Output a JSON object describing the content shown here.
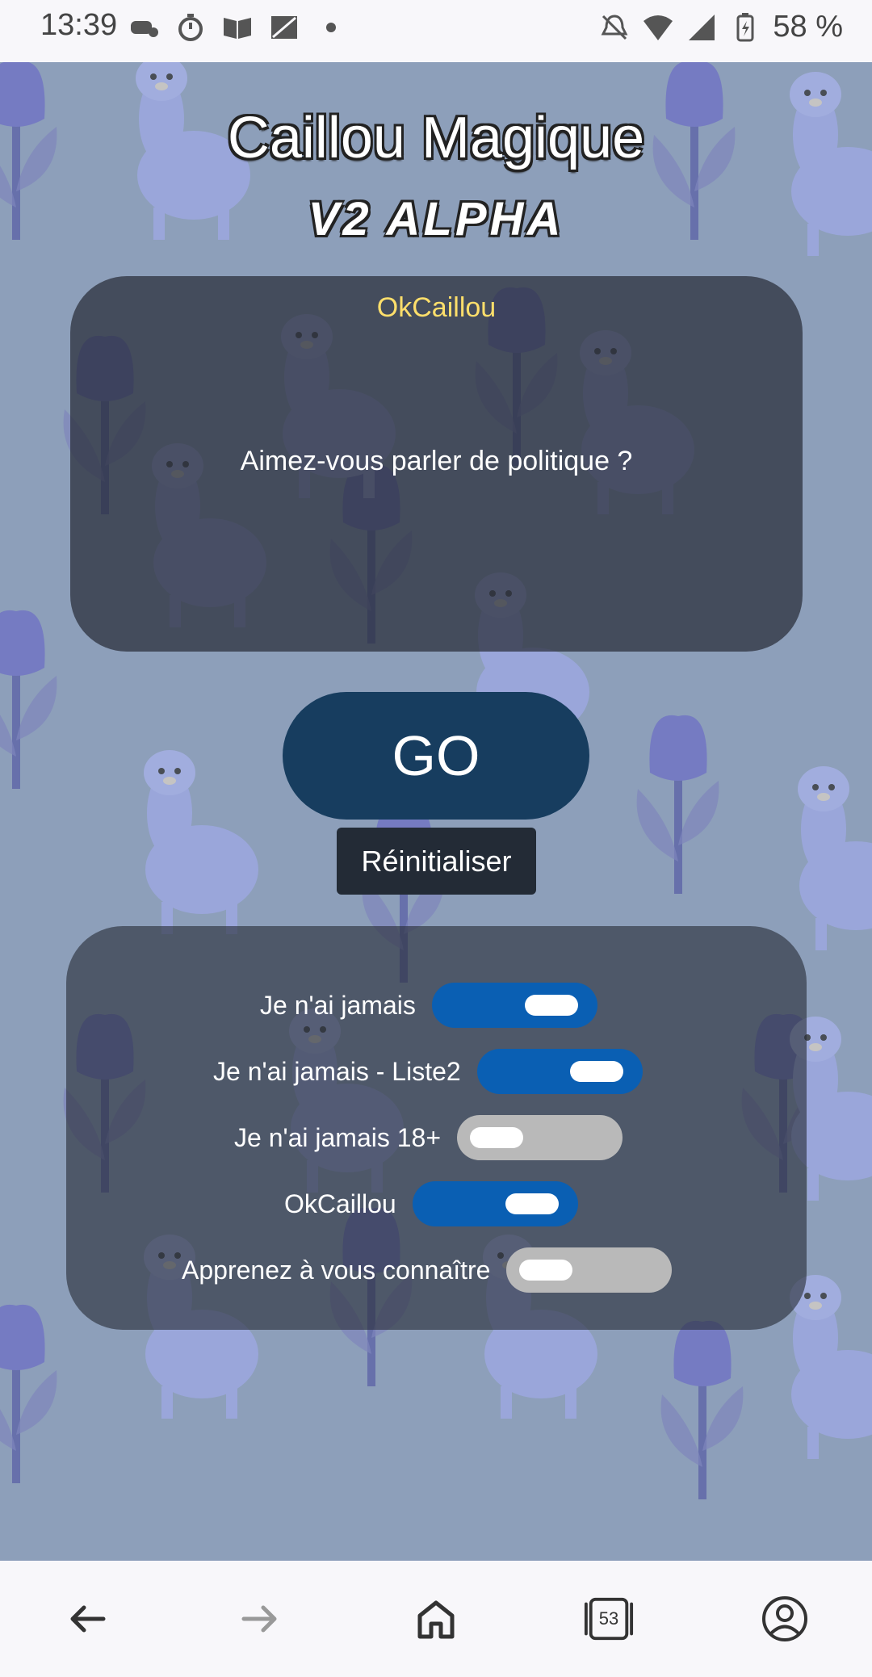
{
  "status_bar": {
    "time": "13:39",
    "battery_pct": "58 %",
    "icons_left": [
      "gamepad-icon",
      "timer-icon",
      "book-icon",
      "image-icon",
      "dot-icon"
    ],
    "icons_right": [
      "bell-off-icon",
      "wifi-icon",
      "signal-icon",
      "battery-icon"
    ]
  },
  "app": {
    "title": "Caillou Magique",
    "subtitle": "V2 ALPHA"
  },
  "question_card": {
    "category": "OkCaillou",
    "question": "Aimez-vous parler de politique ?"
  },
  "buttons": {
    "go": "GO",
    "reset": "Réinitialiser"
  },
  "categories": [
    {
      "label": "Je n'ai jamais",
      "enabled": true
    },
    {
      "label": "Je n'ai jamais - Liste2",
      "enabled": true
    },
    {
      "label": "Je n'ai jamais 18+",
      "enabled": false
    },
    {
      "label": "OkCaillou",
      "enabled": true
    },
    {
      "label": "Apprenez à vous connaître",
      "enabled": false
    }
  ],
  "bottom_nav": {
    "tab_count": "53",
    "items": [
      "back-icon",
      "forward-icon",
      "home-icon",
      "tabs-icon",
      "account-icon"
    ]
  },
  "colors": {
    "background": "#8d9fba",
    "category_text": "#ffdf6b",
    "go_button": "#173d5f",
    "toggle_on": "#0a5fb3",
    "toggle_off": "#b9b9b9"
  }
}
